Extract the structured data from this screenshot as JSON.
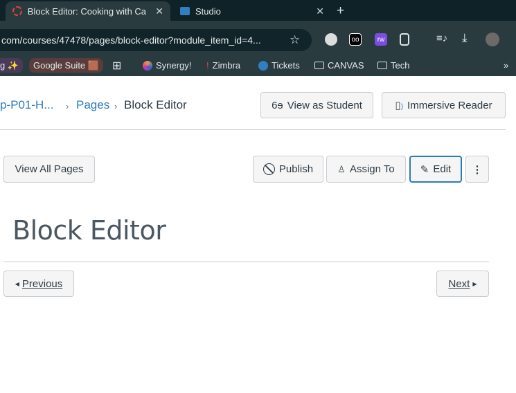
{
  "browser": {
    "tabs": [
      {
        "title": "Block Editor: Cooking with Ca",
        "active": true,
        "icon": "canvas-icon"
      },
      {
        "title": "Studio",
        "active": false,
        "icon": "studio-icon"
      }
    ],
    "new_tab": "+",
    "url": "com/courses/47478/pages/block-editor?module_item_id=4...",
    "bookmarks": [
      {
        "label": "g ✨"
      },
      {
        "label": "Google Suite 🟫"
      },
      {
        "label": "Synergy!"
      },
      {
        "label": "Zimbra"
      },
      {
        "label": "Tickets"
      },
      {
        "label": "CANVAS"
      },
      {
        "label": "Tech"
      }
    ],
    "more": "»"
  },
  "breadcrumb": {
    "course": "p-P01-H...",
    "pages": "Pages",
    "current": "Block Editor",
    "separator": "›"
  },
  "header_buttons": {
    "view_as_student": "View as Student",
    "immersive_reader": "Immersive Reader"
  },
  "actions": {
    "view_all_pages": "View All Pages",
    "publish": "Publish",
    "assign_to": "Assign To",
    "edit": "Edit",
    "more": "⋮"
  },
  "page_title": "Block Editor",
  "nav": {
    "previous": "Previous",
    "next": "Next"
  },
  "colors": {
    "link": "#2b7abc",
    "edit_border": "#2b7abc",
    "chrome_bg": "#2a3b40"
  }
}
